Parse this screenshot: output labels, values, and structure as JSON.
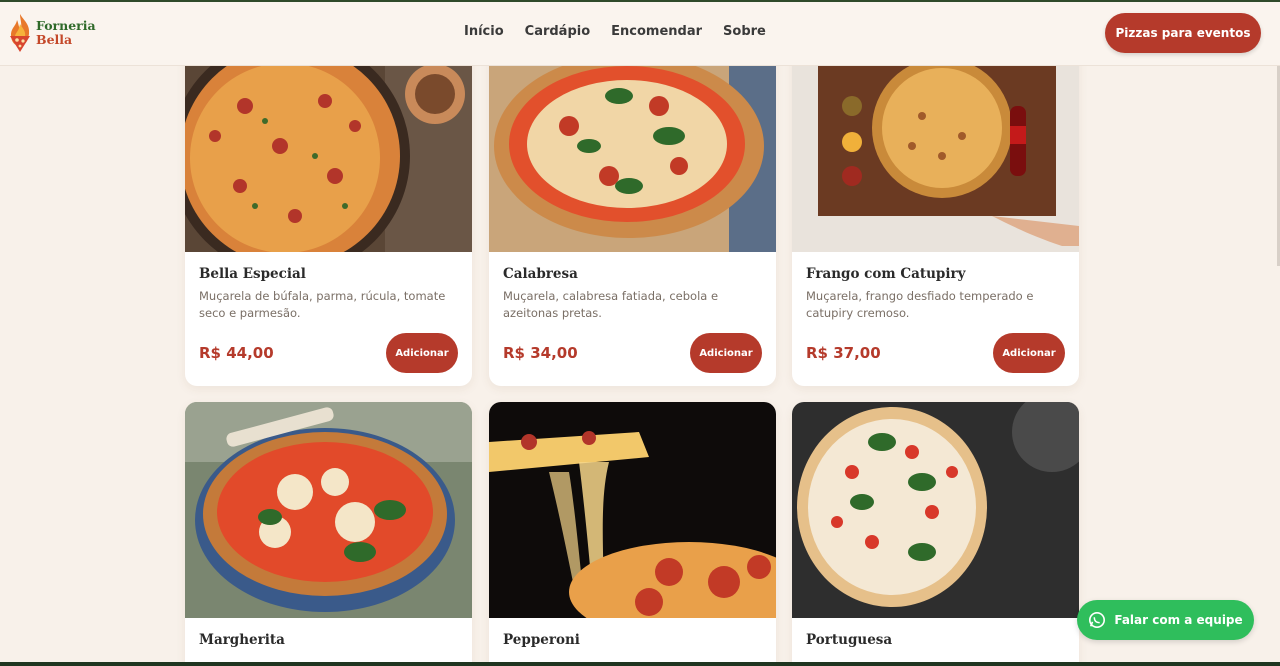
{
  "brand": {
    "line1": "Forneria",
    "line2": "Bella",
    "icon": "flame-pizza-icon"
  },
  "nav": [
    "Início",
    "Cardápio",
    "Encomendar",
    "Sobre"
  ],
  "cta": "Pizzas para eventos",
  "products": [
    {
      "name": "Bella Especial",
      "desc": "Muçarela de búfala, parma, rúcula, tomate seco e parmesão.",
      "price": "R$ 44,00",
      "button": "Adicionar"
    },
    {
      "name": "Calabresa",
      "desc": "Muçarela, calabresa fatiada, cebola e azeitonas pretas.",
      "price": "R$ 34,00",
      "button": "Adicionar"
    },
    {
      "name": "Frango com Catupiry",
      "desc": "Muçarela, frango desfiado temperado e catupiry cremoso.",
      "price": "R$ 37,00",
      "button": "Adicionar"
    },
    {
      "name": "Margherita",
      "desc": "",
      "price": "",
      "button": ""
    },
    {
      "name": "Pepperoni",
      "desc": "",
      "price": "",
      "button": ""
    },
    {
      "name": "Portuguesa",
      "desc": "",
      "price": "",
      "button": ""
    }
  ],
  "whatsapp": {
    "label": "Falar com a equipe",
    "icon": "whatsapp-icon"
  },
  "colors": {
    "accent": "#b53a2b",
    "whatsapp": "#2fbe5c",
    "background": "#f8f1ea"
  }
}
